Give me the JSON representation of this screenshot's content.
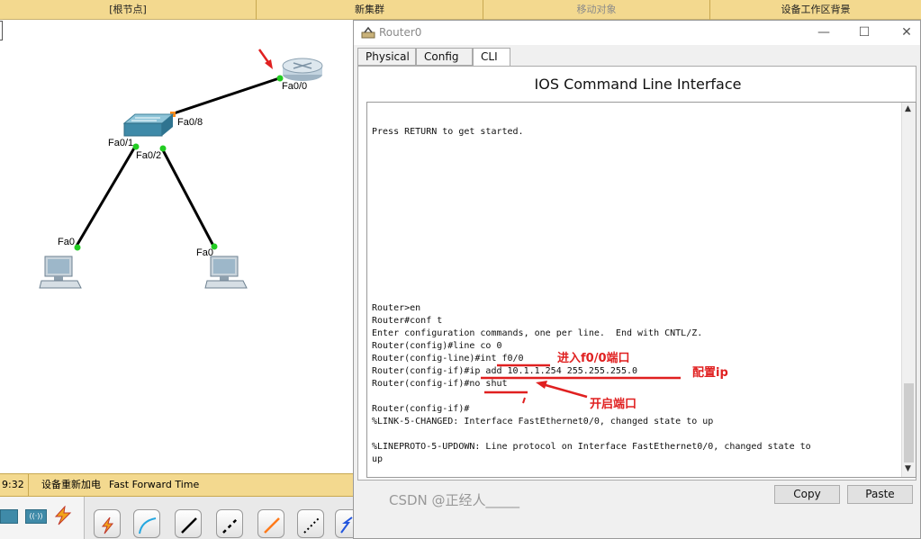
{
  "topbar": {
    "root_node": "[根节点]",
    "new_cluster": "新集群",
    "move_object": "移动对象",
    "set_background": "设备工作区背景"
  },
  "topology": {
    "router_port": "Fa0/0",
    "switch_uplink_port": "Fa0/8",
    "switch_port_1": "Fa0/1",
    "switch_port_2": "Fa0/2",
    "pc1_port": "Fa0",
    "pc2_port": "Fa0"
  },
  "statusbar": {
    "time": "9:32",
    "power_cycle": "设备重新加电",
    "fast_forward": "Fast Forward Time"
  },
  "window": {
    "title": "Router0",
    "minimize": "—",
    "maximize": "☐",
    "close": "✕",
    "tabs": [
      {
        "label": "Physical"
      },
      {
        "label": "Config"
      },
      {
        "label": "CLI"
      }
    ],
    "heading": "IOS Command Line Interface",
    "console_lines": [
      "Press RETURN to get started.",
      "Router>en",
      "Router#conf t",
      "Enter configuration commands, one per line.  End with CNTL/Z.",
      "Router(config)#line co 0",
      "Router(config-line)#int f0/0",
      "Router(config-if)#ip add 10.1.1.254 255.255.255.0",
      "Router(config-if)#no shut",
      "Router(config-if)#",
      "%LINK-5-CHANGED: Interface FastEthernet0/0, changed state to up",
      "%LINEPROTO-5-UPDOWN: Line protocol on Interface FastEthernet0/0, changed state to",
      "up"
    ],
    "annotations": {
      "enter_port": "进入f0/0端口",
      "configure_ip": "配置ip",
      "open_port": "开启端口"
    },
    "copy_button": "Copy",
    "paste_button": "Paste"
  },
  "watermark": "CSDN @正经人_____",
  "colors": {
    "topbar": "#f3d98f",
    "annotation": "#e02020",
    "link_green": "#22cc22",
    "link_orange": "#ff8c1a"
  }
}
